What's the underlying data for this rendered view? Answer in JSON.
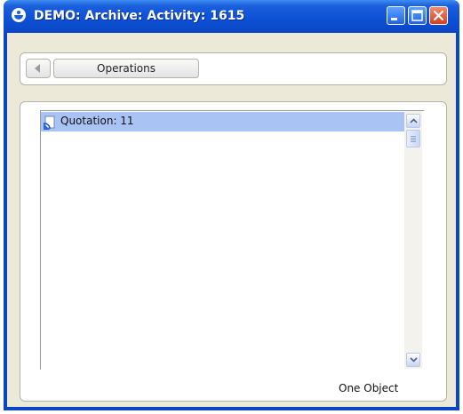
{
  "window": {
    "title": "DEMO: Archive: Activity: 1615",
    "title_bar_color": "#0a46c4",
    "client_color": "#ece9d8",
    "icons": {
      "app": "app-logo-icon",
      "minimize": "minimize-icon",
      "maximize": "maximize-icon",
      "close": "close-icon"
    }
  },
  "toolbar": {
    "back_icon": "back-arrow-icon",
    "operations_label": "Operations"
  },
  "list": {
    "items": [
      {
        "label": "Quotation: 11",
        "icon": "quotation-icon",
        "selected": true
      }
    ],
    "selection_color": "#aac3f5"
  },
  "scrollbar": {
    "up_icon": "scroll-up-arrow-icon",
    "down_icon": "scroll-down-arrow-icon"
  },
  "status": {
    "text": "One Object"
  }
}
